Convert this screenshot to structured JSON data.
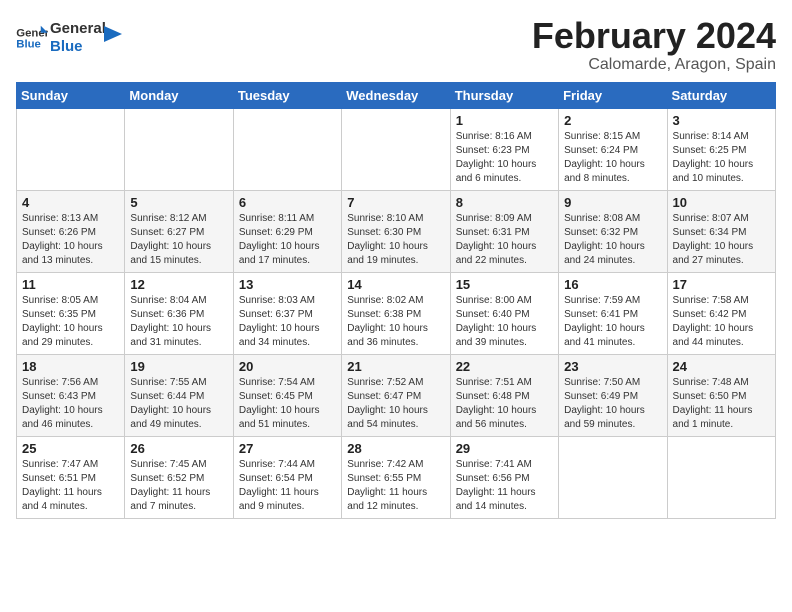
{
  "logo": {
    "line1": "General",
    "line2": "Blue"
  },
  "title": "February 2024",
  "subtitle": "Calomarde, Aragon, Spain",
  "weekdays": [
    "Sunday",
    "Monday",
    "Tuesday",
    "Wednesday",
    "Thursday",
    "Friday",
    "Saturday"
  ],
  "rows": [
    [
      {
        "day": "",
        "info": ""
      },
      {
        "day": "",
        "info": ""
      },
      {
        "day": "",
        "info": ""
      },
      {
        "day": "",
        "info": ""
      },
      {
        "day": "1",
        "info": "Sunrise: 8:16 AM\nSunset: 6:23 PM\nDaylight: 10 hours\nand 6 minutes."
      },
      {
        "day": "2",
        "info": "Sunrise: 8:15 AM\nSunset: 6:24 PM\nDaylight: 10 hours\nand 8 minutes."
      },
      {
        "day": "3",
        "info": "Sunrise: 8:14 AM\nSunset: 6:25 PM\nDaylight: 10 hours\nand 10 minutes."
      }
    ],
    [
      {
        "day": "4",
        "info": "Sunrise: 8:13 AM\nSunset: 6:26 PM\nDaylight: 10 hours\nand 13 minutes."
      },
      {
        "day": "5",
        "info": "Sunrise: 8:12 AM\nSunset: 6:27 PM\nDaylight: 10 hours\nand 15 minutes."
      },
      {
        "day": "6",
        "info": "Sunrise: 8:11 AM\nSunset: 6:29 PM\nDaylight: 10 hours\nand 17 minutes."
      },
      {
        "day": "7",
        "info": "Sunrise: 8:10 AM\nSunset: 6:30 PM\nDaylight: 10 hours\nand 19 minutes."
      },
      {
        "day": "8",
        "info": "Sunrise: 8:09 AM\nSunset: 6:31 PM\nDaylight: 10 hours\nand 22 minutes."
      },
      {
        "day": "9",
        "info": "Sunrise: 8:08 AM\nSunset: 6:32 PM\nDaylight: 10 hours\nand 24 minutes."
      },
      {
        "day": "10",
        "info": "Sunrise: 8:07 AM\nSunset: 6:34 PM\nDaylight: 10 hours\nand 27 minutes."
      }
    ],
    [
      {
        "day": "11",
        "info": "Sunrise: 8:05 AM\nSunset: 6:35 PM\nDaylight: 10 hours\nand 29 minutes."
      },
      {
        "day": "12",
        "info": "Sunrise: 8:04 AM\nSunset: 6:36 PM\nDaylight: 10 hours\nand 31 minutes."
      },
      {
        "day": "13",
        "info": "Sunrise: 8:03 AM\nSunset: 6:37 PM\nDaylight: 10 hours\nand 34 minutes."
      },
      {
        "day": "14",
        "info": "Sunrise: 8:02 AM\nSunset: 6:38 PM\nDaylight: 10 hours\nand 36 minutes."
      },
      {
        "day": "15",
        "info": "Sunrise: 8:00 AM\nSunset: 6:40 PM\nDaylight: 10 hours\nand 39 minutes."
      },
      {
        "day": "16",
        "info": "Sunrise: 7:59 AM\nSunset: 6:41 PM\nDaylight: 10 hours\nand 41 minutes."
      },
      {
        "day": "17",
        "info": "Sunrise: 7:58 AM\nSunset: 6:42 PM\nDaylight: 10 hours\nand 44 minutes."
      }
    ],
    [
      {
        "day": "18",
        "info": "Sunrise: 7:56 AM\nSunset: 6:43 PM\nDaylight: 10 hours\nand 46 minutes."
      },
      {
        "day": "19",
        "info": "Sunrise: 7:55 AM\nSunset: 6:44 PM\nDaylight: 10 hours\nand 49 minutes."
      },
      {
        "day": "20",
        "info": "Sunrise: 7:54 AM\nSunset: 6:45 PM\nDaylight: 10 hours\nand 51 minutes."
      },
      {
        "day": "21",
        "info": "Sunrise: 7:52 AM\nSunset: 6:47 PM\nDaylight: 10 hours\nand 54 minutes."
      },
      {
        "day": "22",
        "info": "Sunrise: 7:51 AM\nSunset: 6:48 PM\nDaylight: 10 hours\nand 56 minutes."
      },
      {
        "day": "23",
        "info": "Sunrise: 7:50 AM\nSunset: 6:49 PM\nDaylight: 10 hours\nand 59 minutes."
      },
      {
        "day": "24",
        "info": "Sunrise: 7:48 AM\nSunset: 6:50 PM\nDaylight: 11 hours\nand 1 minute."
      }
    ],
    [
      {
        "day": "25",
        "info": "Sunrise: 7:47 AM\nSunset: 6:51 PM\nDaylight: 11 hours\nand 4 minutes."
      },
      {
        "day": "26",
        "info": "Sunrise: 7:45 AM\nSunset: 6:52 PM\nDaylight: 11 hours\nand 7 minutes."
      },
      {
        "day": "27",
        "info": "Sunrise: 7:44 AM\nSunset: 6:54 PM\nDaylight: 11 hours\nand 9 minutes."
      },
      {
        "day": "28",
        "info": "Sunrise: 7:42 AM\nSunset: 6:55 PM\nDaylight: 11 hours\nand 12 minutes."
      },
      {
        "day": "29",
        "info": "Sunrise: 7:41 AM\nSunset: 6:56 PM\nDaylight: 11 hours\nand 14 minutes."
      },
      {
        "day": "",
        "info": ""
      },
      {
        "day": "",
        "info": ""
      }
    ]
  ]
}
